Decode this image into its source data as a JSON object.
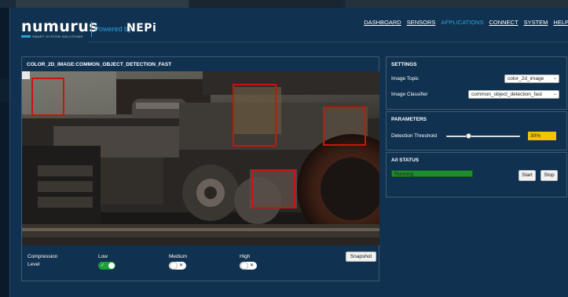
{
  "header": {
    "logo_name": "numurus",
    "logo_tagline": "SMART SYSTEM SOLUTIONS",
    "powered_by": "Powered by",
    "brand": "NEPi"
  },
  "nav": [
    {
      "label": "DASHBOARD",
      "active": false
    },
    {
      "label": "SENSORS",
      "active": false
    },
    {
      "label": "APPLICATIONS",
      "active": true
    },
    {
      "label": "CONNECT",
      "active": false
    },
    {
      "label": "SYSTEM",
      "active": false
    },
    {
      "label": "HELP",
      "active": false
    }
  ],
  "image_panel": {
    "title": "COLOR_2D_IMAGE:COMMON_OBJECT_DETECTION_FAST",
    "compression_label_1": "Compression",
    "compression_label_2": "Level",
    "levels": [
      {
        "label": "Low",
        "on": true
      },
      {
        "label": "Medium",
        "on": false
      },
      {
        "label": "High",
        "on": false
      }
    ],
    "snapshot_label": "Snapshot"
  },
  "settings": {
    "title": "SETTINGS",
    "image_topic_label": "Image Topic",
    "image_topic_value": "color_2d_image",
    "image_classifier_label": "Image Classifier",
    "image_classifier_value": "common_object_detection_fast"
  },
  "parameters": {
    "title": "PARAMETERS",
    "threshold_label": "Detection Threshold",
    "threshold_value": "30%",
    "threshold_fraction": 0.3
  },
  "ai_status": {
    "title": "A/I STATUS",
    "status": "Running",
    "start_label": "Start",
    "stop_label": "Stop"
  },
  "colors": {
    "accent": "#2d9fd8",
    "background": "#10314f",
    "detection": "#d01010",
    "status_running": "#1f8c2f",
    "threshold_box": "#f5c400"
  }
}
